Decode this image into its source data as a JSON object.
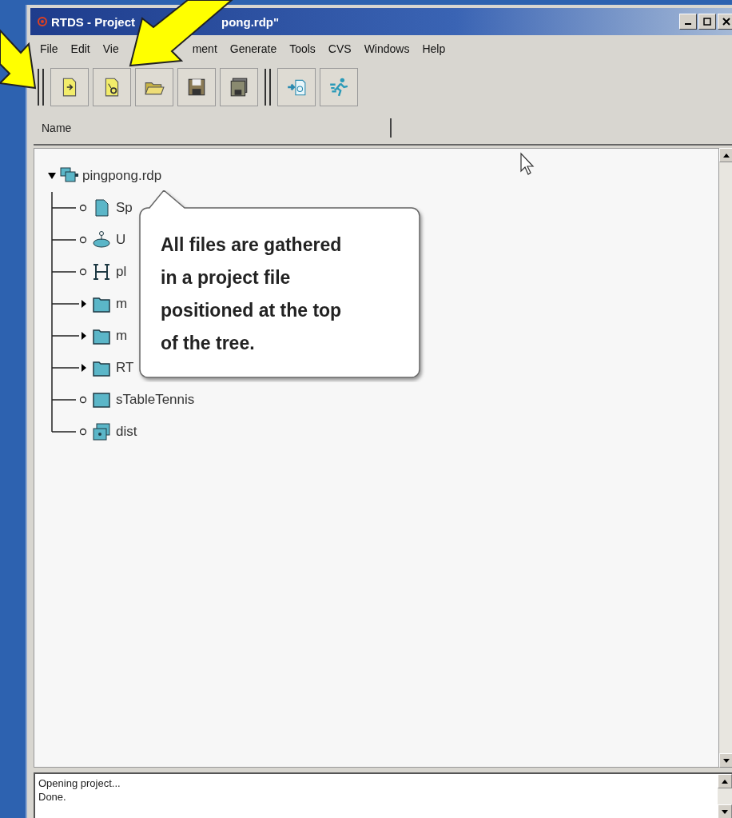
{
  "window": {
    "title_start": "RTDS - Project",
    "title_end": "pong.rdp\""
  },
  "menu": [
    "File",
    "Edit",
    "Vie",
    "ment",
    "Generate",
    "Tools",
    "CVS",
    "Windows",
    "Help"
  ],
  "column_header": "Name",
  "tree": {
    "label": "pingpong.rdp",
    "kind": "project",
    "expanded": true,
    "children": [
      {
        "label": "Sp",
        "kind": "document"
      },
      {
        "label": "U",
        "kind": "usecase"
      },
      {
        "label": "pl",
        "kind": "architecture"
      },
      {
        "label": "m",
        "kind": "folder",
        "expanded": false
      },
      {
        "label": "m",
        "kind": "folder",
        "expanded": false
      },
      {
        "label": "RT",
        "kind": "folder",
        "expanded": false
      },
      {
        "label": "sTableTennis",
        "kind": "class"
      },
      {
        "label": "dist",
        "kind": "deployment"
      }
    ]
  },
  "callout": "All files are gathered\nin a project file\npositioned at the top\nof the tree.",
  "log": [
    "Opening project...",
    "Done."
  ]
}
